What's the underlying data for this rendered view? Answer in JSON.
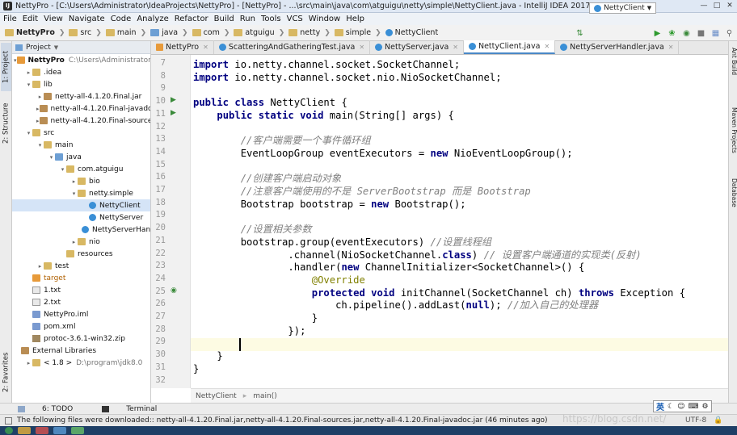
{
  "window": {
    "title": "NettyPro - [C:\\Users\\Administrator\\IdeaProjects\\NettyPro] - [NettyPro] - ...\\src\\main\\java\\com\\atguigu\\netty\\simple\\NettyClient.java - IntelliJ IDEA 2017.2.5",
    "app_icon": "IJ"
  },
  "menu": [
    "File",
    "Edit",
    "View",
    "Navigate",
    "Code",
    "Analyze",
    "Refactor",
    "Build",
    "Run",
    "Tools",
    "VCS",
    "Window",
    "Help"
  ],
  "breadcrumbs": [
    "NettyPro",
    "src",
    "main",
    "java",
    "com",
    "atguigu",
    "netty",
    "simple",
    "NettyClient"
  ],
  "run_config": "NettyClient",
  "left_tool_tabs": {
    "project": "1: Project",
    "structure": "2: Structure",
    "favorites": "2: Favorites"
  },
  "right_tool_tabs": {
    "ant": "Ant Build",
    "maven": "Maven Projects",
    "database": "Database"
  },
  "project_panel": {
    "title": "Project"
  },
  "tree": [
    {
      "label": "NettyPro",
      "hint": "C:\\Users\\Administrator\\IdeaP",
      "bold": true
    },
    {
      "label": ".idea"
    },
    {
      "label": "lib"
    },
    {
      "label": "netty-all-4.1.20.Final.jar"
    },
    {
      "label": "netty-all-4.1.20.Final-javadoc.jar"
    },
    {
      "label": "netty-all-4.1.20.Final-sources.jar"
    },
    {
      "label": "src"
    },
    {
      "label": "main"
    },
    {
      "label": "java"
    },
    {
      "label": "com.atguigu"
    },
    {
      "label": "bio"
    },
    {
      "label": "netty.simple"
    },
    {
      "label": "NettyClient"
    },
    {
      "label": "NettyServer"
    },
    {
      "label": "NettyServerHandler"
    },
    {
      "label": "nio"
    },
    {
      "label": "resources"
    },
    {
      "label": "test"
    },
    {
      "label": "target"
    },
    {
      "label": "1.txt"
    },
    {
      "label": "2.txt"
    },
    {
      "label": "NettyPro.iml"
    },
    {
      "label": "pom.xml"
    },
    {
      "label": "protoc-3.6.1-win32.zip"
    },
    {
      "label": "External Libraries"
    },
    {
      "label": "< 1.8 >",
      "hint": "D:\\program\\jdk8.0"
    }
  ],
  "editor_tabs": [
    {
      "label": "NettyPro",
      "active": false
    },
    {
      "label": "ScatteringAndGatheringTest.java",
      "active": false
    },
    {
      "label": "NettyServer.java",
      "active": false
    },
    {
      "label": "NettyClient.java",
      "active": true
    },
    {
      "label": "NettyServerHandler.java",
      "active": false
    }
  ],
  "line_numbers": [
    "7",
    "8",
    "9",
    "10",
    "11",
    "12",
    "13",
    "14",
    "15",
    "16",
    "17",
    "18",
    "19",
    "20",
    "21",
    "22",
    "23",
    "24",
    "25",
    "26",
    "27",
    "28",
    "29",
    "30",
    "31",
    "32"
  ],
  "code": [
    [
      [
        "kw",
        "import"
      ],
      [
        "t",
        " io.netty.channel.socket.SocketChannel;"
      ]
    ],
    [
      [
        "kw",
        "import"
      ],
      [
        "t",
        " io.netty.channel.socket.nio.NioSocketChannel;"
      ]
    ],
    [],
    [
      [
        "kw",
        "public class"
      ],
      [
        "t",
        " NettyClient {"
      ]
    ],
    [
      [
        "t",
        "    "
      ],
      [
        "kw",
        "public static void"
      ],
      [
        "t",
        " main(String[] args) {"
      ]
    ],
    [],
    [
      [
        "t",
        "        "
      ],
      [
        "cm",
        "//客户端需要一个事件循环组"
      ]
    ],
    [
      [
        "t",
        "        EventLoopGroup eventExecutors = "
      ],
      [
        "kw",
        "new"
      ],
      [
        "t",
        " NioEventLoopGroup();"
      ]
    ],
    [],
    [
      [
        "t",
        "        "
      ],
      [
        "cm",
        "//创建客户端启动对象"
      ]
    ],
    [
      [
        "t",
        "        "
      ],
      [
        "cm",
        "//注意客户端使用的不是 ServerBootstrap 而是 Bootstrap"
      ]
    ],
    [
      [
        "t",
        "        Bootstrap bootstrap = "
      ],
      [
        "kw",
        "new"
      ],
      [
        "t",
        " Bootstrap();"
      ]
    ],
    [],
    [
      [
        "t",
        "        "
      ],
      [
        "cm",
        "//设置相关参数"
      ]
    ],
    [
      [
        "t",
        "        bootstrap.group(eventExecutors) "
      ],
      [
        "cm",
        "//设置线程组"
      ]
    ],
    [
      [
        "t",
        "                .channel(NioSocketChannel."
      ],
      [
        "kw",
        "class"
      ],
      [
        "t",
        ") "
      ],
      [
        "cm",
        "// 设置客户端通道的实现类(反射)"
      ]
    ],
    [
      [
        "t",
        "                .handler("
      ],
      [
        "kw",
        "new"
      ],
      [
        "t",
        " ChannelInitializer<SocketChannel>() {"
      ]
    ],
    [
      [
        "t",
        "                    "
      ],
      [
        "an",
        "@Override"
      ]
    ],
    [
      [
        "t",
        "                    "
      ],
      [
        "kw",
        "protected void"
      ],
      [
        "t",
        " initChannel(SocketChannel ch) "
      ],
      [
        "kw",
        "throws"
      ],
      [
        "t",
        " Exception {"
      ]
    ],
    [
      [
        "t",
        "                        ch.pipeline().addLast("
      ],
      [
        "kw",
        "null"
      ],
      [
        "t",
        "); "
      ],
      [
        "cm",
        "//加入自己的处理器"
      ]
    ],
    [
      [
        "t",
        "                    }"
      ]
    ],
    [
      [
        "t",
        "                });"
      ]
    ],
    [],
    [
      [
        "t",
        "    }"
      ]
    ],
    [
      [
        "t",
        "}"
      ]
    ],
    []
  ],
  "editor_breadcrumb": [
    "NettyClient",
    "main()"
  ],
  "bottom_tabs": [
    "6: TODO",
    "Terminal"
  ],
  "status": {
    "message": "The following files were downloaded:: netty-all-4.1.20.Final.jar,netty-all-4.1.20.Final-sources.jar,netty-all-4.1.20.Final-javadoc.jar (46 minutes ago)",
    "encoding": "UTF-8"
  },
  "ime": {
    "lang": "英"
  },
  "watermark": "https://blog.csdn.net/"
}
